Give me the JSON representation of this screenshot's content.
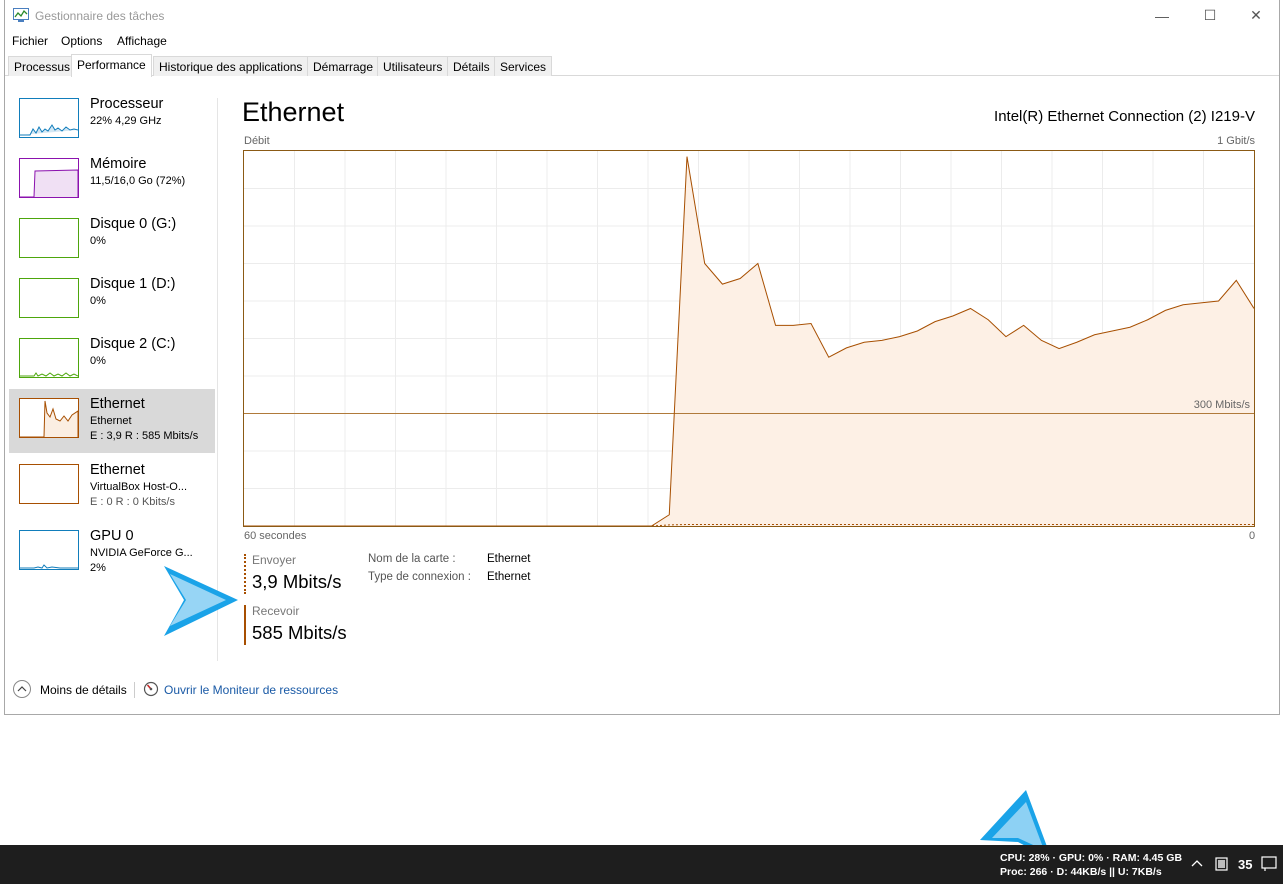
{
  "window": {
    "title": "Gestionnaire des tâches",
    "controls": {
      "minimize": "—",
      "maximize": "☐",
      "close": "✕"
    }
  },
  "menu": [
    "Fichier",
    "Options",
    "Affichage"
  ],
  "tabs": [
    "Processus",
    "Performance",
    "Historique des applications",
    "Démarrage",
    "Utilisateurs",
    "Détails",
    "Services"
  ],
  "active_tab": "Performance",
  "sidebar": {
    "items": [
      {
        "name": "Processeur",
        "line1": "22% 4,29 GHz",
        "line2": "",
        "color": "#117dbb"
      },
      {
        "name": "Mémoire",
        "line1": "11,5/16,0 Go (72%)",
        "line2": "",
        "color": "#8b12ae"
      },
      {
        "name": "Disque 0 (G:)",
        "line1": "0%",
        "line2": "",
        "color": "#4da60c"
      },
      {
        "name": "Disque 1 (D:)",
        "line1": "0%",
        "line2": "",
        "color": "#4da60c"
      },
      {
        "name": "Disque 2 (C:)",
        "line1": "0%",
        "line2": "",
        "color": "#4da60c"
      },
      {
        "name": "Ethernet",
        "line1": "Ethernet",
        "line2": "E : 3,9 R : 585 Mbits/s",
        "color": "#a74f01"
      },
      {
        "name": "Ethernet",
        "line1": "VirtualBox Host-O...",
        "line2": "E : 0 R : 0 Kbits/s",
        "color": "#a74f01"
      },
      {
        "name": "GPU 0",
        "line1": "NVIDIA GeForce G...",
        "line2": "2%",
        "color": "#117dbb"
      }
    ]
  },
  "main": {
    "title": "Ethernet",
    "adapter": "Intel(R) Ethernet Connection (2) I219-V",
    "graph_label": "Débit",
    "graph_max": "1 Gbit/s",
    "graph_ref": "300 Mbits/s",
    "graph_time": "60 secondes",
    "graph_zero": "0",
    "send_label": "Envoyer",
    "send_value": "3,9 Mbits/s",
    "recv_label": "Recevoir",
    "recv_value": "585 Mbits/s",
    "adapter_name_label": "Nom de la carte :",
    "adapter_name_value": "Ethernet",
    "connection_type_label": "Type de connexion :",
    "connection_type_value": "Ethernet",
    "accent": "#a74f01"
  },
  "chart_data": {
    "type": "area",
    "series": [
      {
        "name": "Recevoir",
        "values": [
          0,
          0,
          0,
          0,
          0,
          0,
          0,
          0,
          0,
          0,
          0,
          0,
          0,
          0,
          0,
          0,
          0,
          0,
          0,
          0,
          0,
          0,
          0,
          0,
          30,
          985,
          700,
          645,
          660,
          700,
          535,
          535,
          540,
          450,
          475,
          490,
          495,
          505,
          520,
          545,
          560,
          580,
          550,
          505,
          535,
          495,
          473,
          490,
          510,
          520,
          530,
          550,
          575,
          590,
          595,
          600,
          655,
          580
        ]
      },
      {
        "name": "Envoyer",
        "values": [
          0,
          0,
          0,
          0,
          0,
          0,
          0,
          0,
          0,
          0,
          0,
          0,
          0,
          0,
          0,
          0,
          0,
          0,
          0,
          0,
          0,
          0,
          0,
          0,
          3,
          4,
          4,
          4,
          4,
          4,
          4,
          4,
          4,
          4,
          4,
          4,
          4,
          4,
          4,
          4,
          4,
          4,
          4,
          4,
          4,
          4,
          4,
          4,
          4,
          4,
          4,
          4,
          4,
          4,
          4,
          4,
          4,
          4
        ]
      }
    ],
    "ylim": [
      0,
      1000
    ],
    "x_range_seconds": [
      60,
      0
    ]
  },
  "footer": {
    "less_details": "Moins de détails",
    "resource_monitor": "Ouvrir le Moniteur de ressources"
  },
  "taskbar": {
    "line1": "CPU: 28% · GPU: 0% · RAM: 4.45 GB",
    "line2": "Proc: 266 · D: 44KB/s || U: 7KB/s",
    "clock": "35"
  }
}
